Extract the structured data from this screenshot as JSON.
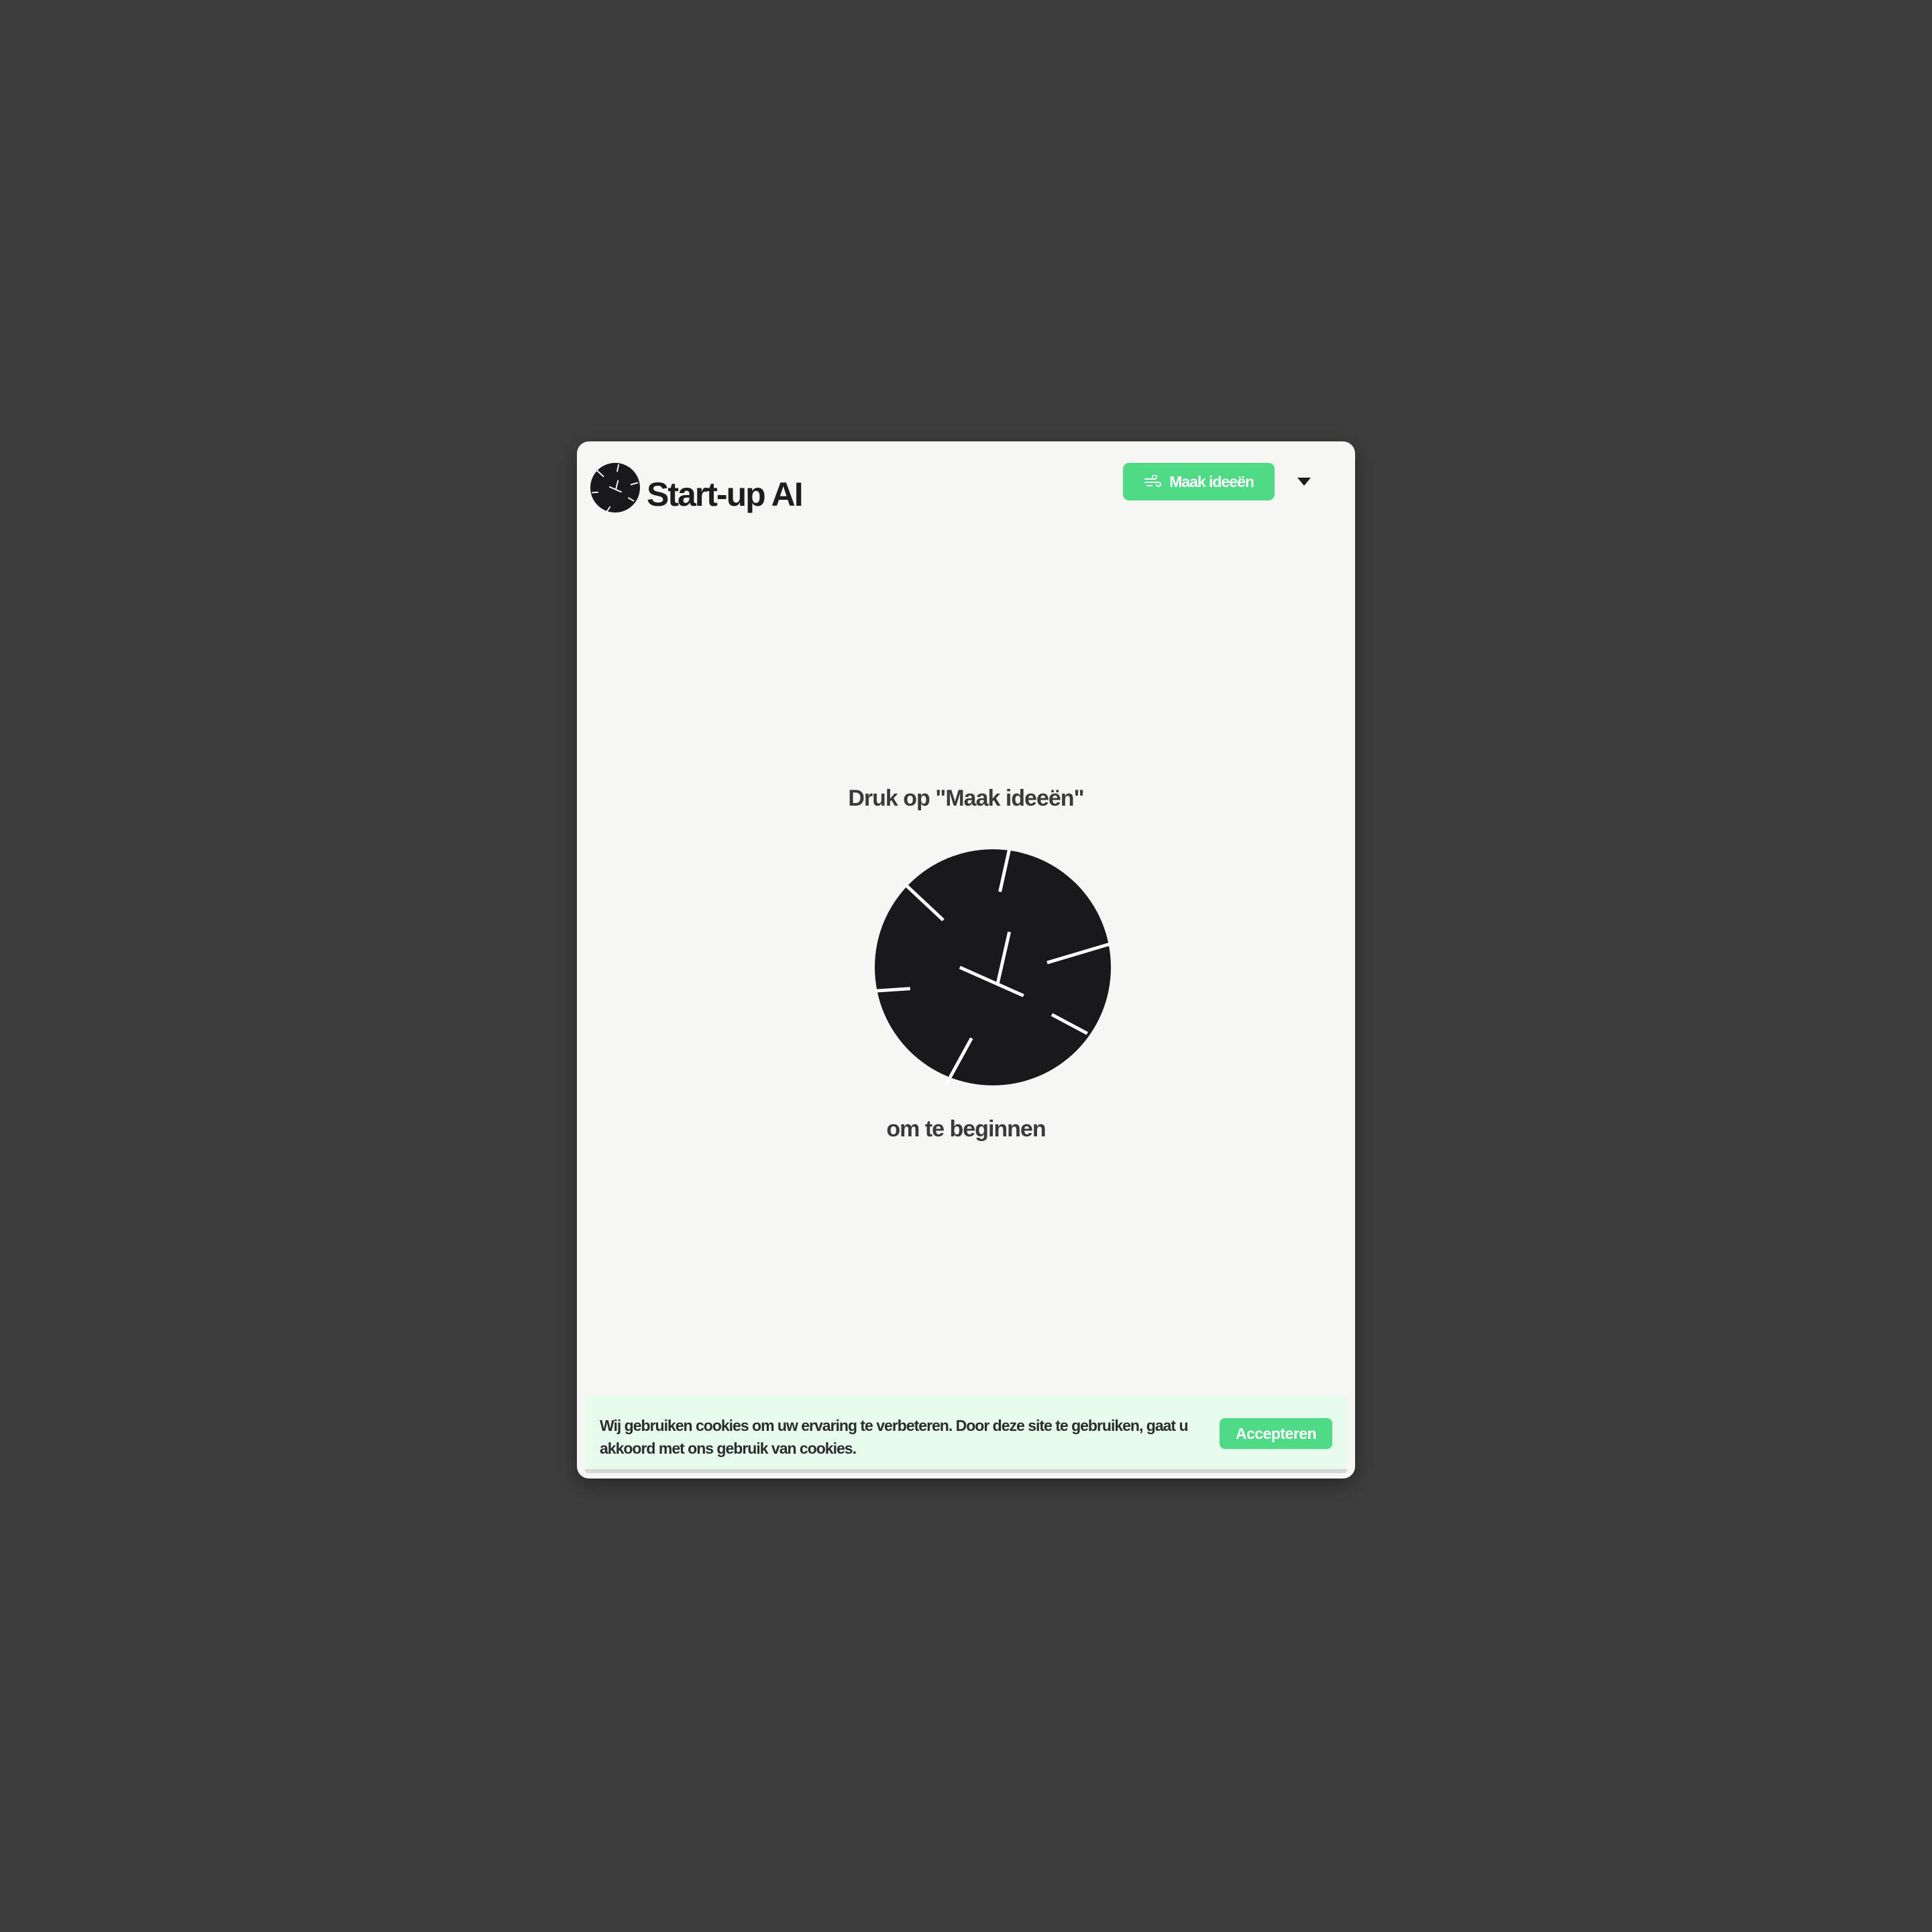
{
  "header": {
    "title": "Start-up AI",
    "logo_icon": "clock-burst-logo-icon",
    "cta_label": "Maak ideeën",
    "cta_icon": "wind-icon",
    "dropdown_icon": "caret-down-icon"
  },
  "main": {
    "prompt_top": "Druk op \"Maak ideeën\"",
    "prompt_bottom": "om te beginnen",
    "illustration_icon": "clock-burst-logo-icon"
  },
  "cookie_banner": {
    "text": "Wij gebruiken cookies om uw ervaring te verbeteren. Door deze site te gebruiken, gaat u akkoord met ons gebruik van cookies.",
    "accept_label": "Accepteren"
  },
  "colors": {
    "background": "#3d3d3d",
    "card": "#f6f6f5",
    "accent": "#4fdb86",
    "cookie_banner_bg": "#e6fbeb",
    "logo_dark": "#19191b"
  }
}
